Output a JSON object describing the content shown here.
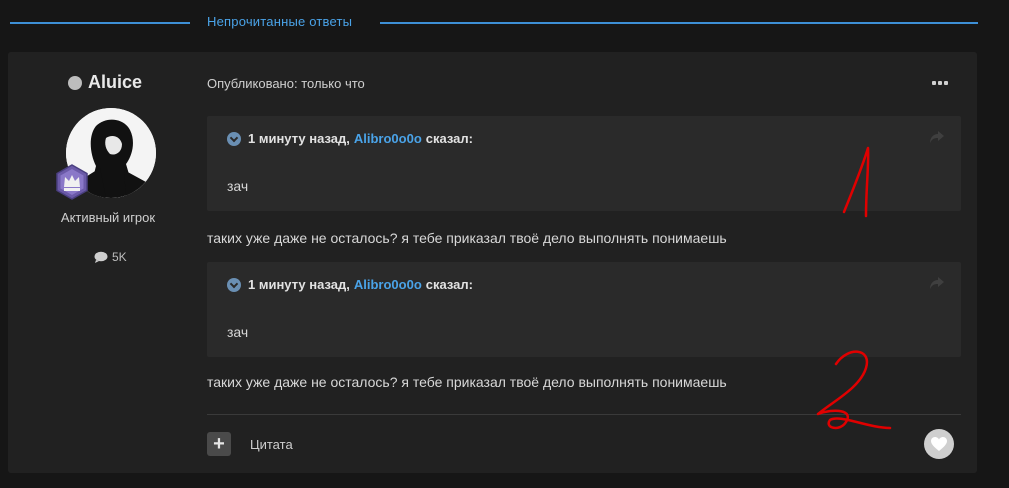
{
  "divider": {
    "label": "Непрочитанные ответы"
  },
  "author": {
    "name": "Aluice",
    "group": "Активный игрок",
    "posts_count": "5K"
  },
  "post": {
    "meta": "Опубликовано: только что",
    "quotes": [
      {
        "time": "1 минуту назад,",
        "user": "Alibro0o0o",
        "said": "сказал:",
        "body": "зач"
      },
      {
        "time": "1 минуту назад,",
        "user": "Alibro0o0o",
        "said": "сказал:",
        "body": "зач"
      }
    ],
    "texts": [
      "таких уже даже не осталось? я тебе приказал твоё дело выполнять понимаешь",
      "таких уже даже не осталось? я тебе приказал твоё дело выполнять понимаешь"
    ]
  },
  "footer": {
    "quote_label": "Цитата"
  },
  "colors": {
    "accent": "#4aa3e8",
    "background": "#161616",
    "panel": "#212121",
    "annotation": "#e00000"
  }
}
